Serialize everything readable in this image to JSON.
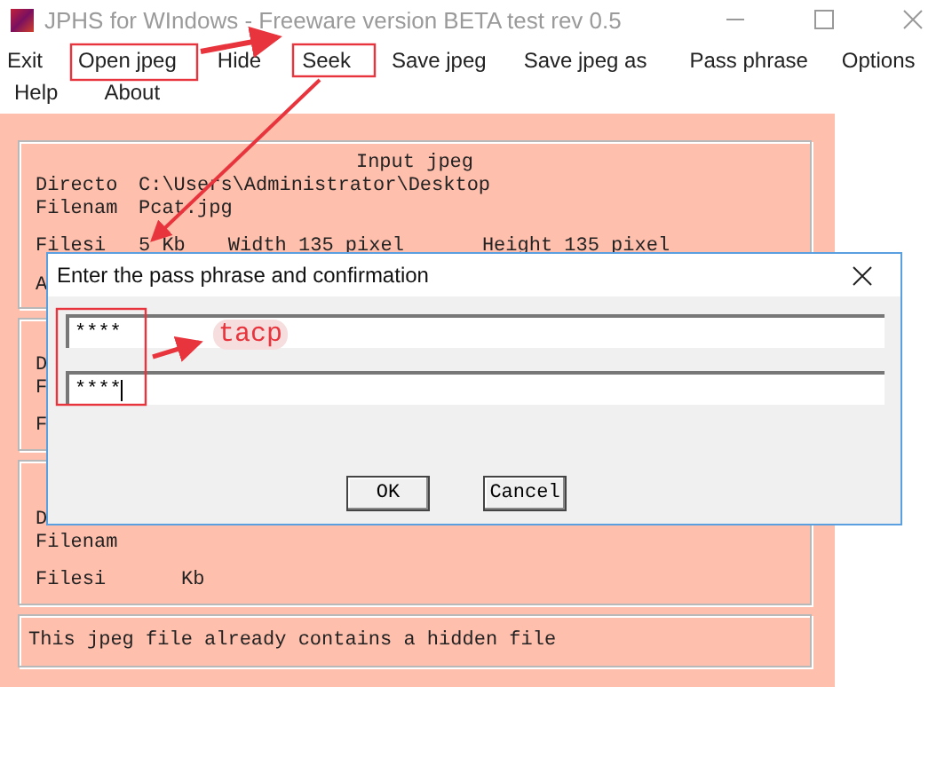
{
  "window": {
    "title": "JPHS for WIndows - Freeware version BETA test rev 0.5"
  },
  "menu": [
    [
      "Exit",
      "Open jpeg",
      "Hide",
      "Seek",
      "Save jpeg",
      "Save jpeg as",
      "Pass phrase",
      "Options"
    ],
    [
      "Help",
      "About"
    ]
  ],
  "panels": [
    {
      "title": "Input jpeg",
      "rows": [
        [
          "Directo",
          "C:\\Users\\Administrator\\Desktop"
        ],
        [
          "Filenam",
          "Pcat.jpg"
        ],
        [
          "Filesi",
          "5 Kb",
          "Width 135 pixel",
          "Height 135 pixel"
        ],
        [
          "A"
        ]
      ]
    },
    {
      "rows": [
        [
          "D"
        ],
        [
          "F"
        ],
        [
          "F"
        ]
      ]
    },
    {
      "rows": [
        [
          "D"
        ],
        [
          "Filenam"
        ],
        [
          "Filesi",
          "Kb"
        ]
      ]
    }
  ],
  "status": "This jpeg file already contains a hidden file",
  "dialog": {
    "title": "Enter the pass phrase and confirmation",
    "fields": [
      {
        "value": "****",
        "focused": false
      },
      {
        "value": "****",
        "focused": true
      }
    ],
    "buttons": [
      "OK",
      "Cancel"
    ]
  },
  "annotation": {
    "note": "tacp"
  }
}
